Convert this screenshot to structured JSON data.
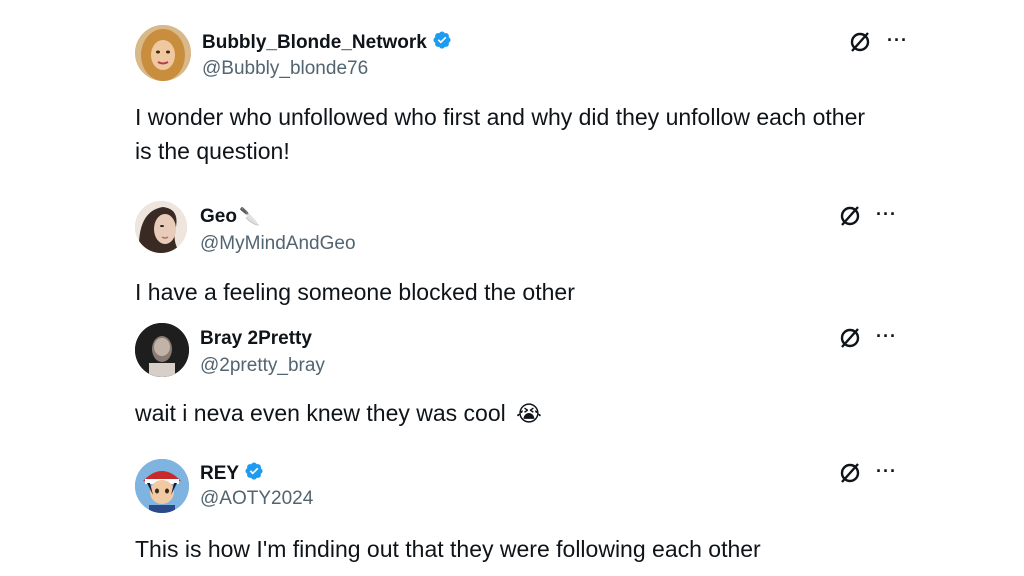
{
  "posts": [
    {
      "name": "Bubbly_Blonde_Network",
      "handle": "@Bubbly_blonde76",
      "verified": true,
      "text_lines": [
        "I wonder who unfollowed who first and why did they unfollow each other",
        "is the question!"
      ],
      "avatar_icon": "avatar-blonde-woman"
    },
    {
      "name": "Geo",
      "handle": "@MyMindAndGeo",
      "verified": false,
      "name_emoji": "🔪",
      "text_lines": [
        "I have a feeling someone blocked the other"
      ],
      "avatar_icon": "avatar-dark-hair-woman"
    },
    {
      "name": "Bray 2Pretty",
      "handle": "@2pretty_bray",
      "verified": false,
      "text_lines": [
        "wait i neva even knew they was cool"
      ],
      "text_emoji": "😭",
      "avatar_icon": "avatar-dark-photo"
    },
    {
      "name": "REY",
      "handle": "@AOTY2024",
      "verified": true,
      "text_lines": [
        "This is how I'm finding out that they were following each other"
      ],
      "avatar_icon": "avatar-anime-character"
    }
  ],
  "more_label": "···",
  "colors": {
    "verified_blue": "#1d9bf0",
    "handle_gray": "#536471",
    "text": "#0f1419"
  }
}
